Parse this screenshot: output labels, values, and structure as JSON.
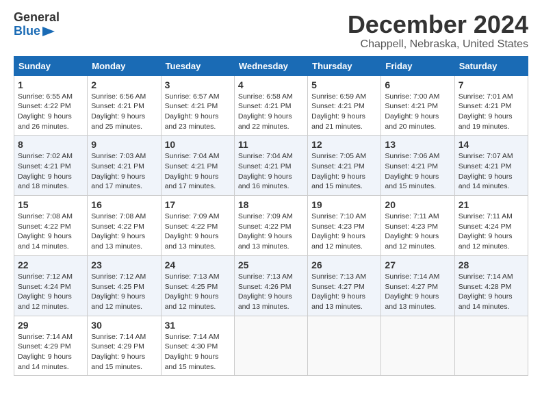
{
  "logo": {
    "line1": "General",
    "line2": "Blue"
  },
  "title": "December 2024",
  "location": "Chappell, Nebraska, United States",
  "weekdays": [
    "Sunday",
    "Monday",
    "Tuesday",
    "Wednesday",
    "Thursday",
    "Friday",
    "Saturday"
  ],
  "weeks": [
    [
      {
        "day": "1",
        "sunrise": "6:55 AM",
        "sunset": "4:22 PM",
        "daylight": "9 hours and 26 minutes."
      },
      {
        "day": "2",
        "sunrise": "6:56 AM",
        "sunset": "4:21 PM",
        "daylight": "9 hours and 25 minutes."
      },
      {
        "day": "3",
        "sunrise": "6:57 AM",
        "sunset": "4:21 PM",
        "daylight": "9 hours and 23 minutes."
      },
      {
        "day": "4",
        "sunrise": "6:58 AM",
        "sunset": "4:21 PM",
        "daylight": "9 hours and 22 minutes."
      },
      {
        "day": "5",
        "sunrise": "6:59 AM",
        "sunset": "4:21 PM",
        "daylight": "9 hours and 21 minutes."
      },
      {
        "day": "6",
        "sunrise": "7:00 AM",
        "sunset": "4:21 PM",
        "daylight": "9 hours and 20 minutes."
      },
      {
        "day": "7",
        "sunrise": "7:01 AM",
        "sunset": "4:21 PM",
        "daylight": "9 hours and 19 minutes."
      }
    ],
    [
      {
        "day": "8",
        "sunrise": "7:02 AM",
        "sunset": "4:21 PM",
        "daylight": "9 hours and 18 minutes."
      },
      {
        "day": "9",
        "sunrise": "7:03 AM",
        "sunset": "4:21 PM",
        "daylight": "9 hours and 17 minutes."
      },
      {
        "day": "10",
        "sunrise": "7:04 AM",
        "sunset": "4:21 PM",
        "daylight": "9 hours and 17 minutes."
      },
      {
        "day": "11",
        "sunrise": "7:04 AM",
        "sunset": "4:21 PM",
        "daylight": "9 hours and 16 minutes."
      },
      {
        "day": "12",
        "sunrise": "7:05 AM",
        "sunset": "4:21 PM",
        "daylight": "9 hours and 15 minutes."
      },
      {
        "day": "13",
        "sunrise": "7:06 AM",
        "sunset": "4:21 PM",
        "daylight": "9 hours and 15 minutes."
      },
      {
        "day": "14",
        "sunrise": "7:07 AM",
        "sunset": "4:21 PM",
        "daylight": "9 hours and 14 minutes."
      }
    ],
    [
      {
        "day": "15",
        "sunrise": "7:08 AM",
        "sunset": "4:22 PM",
        "daylight": "9 hours and 14 minutes."
      },
      {
        "day": "16",
        "sunrise": "7:08 AM",
        "sunset": "4:22 PM",
        "daylight": "9 hours and 13 minutes."
      },
      {
        "day": "17",
        "sunrise": "7:09 AM",
        "sunset": "4:22 PM",
        "daylight": "9 hours and 13 minutes."
      },
      {
        "day": "18",
        "sunrise": "7:09 AM",
        "sunset": "4:22 PM",
        "daylight": "9 hours and 13 minutes."
      },
      {
        "day": "19",
        "sunrise": "7:10 AM",
        "sunset": "4:23 PM",
        "daylight": "9 hours and 12 minutes."
      },
      {
        "day": "20",
        "sunrise": "7:11 AM",
        "sunset": "4:23 PM",
        "daylight": "9 hours and 12 minutes."
      },
      {
        "day": "21",
        "sunrise": "7:11 AM",
        "sunset": "4:24 PM",
        "daylight": "9 hours and 12 minutes."
      }
    ],
    [
      {
        "day": "22",
        "sunrise": "7:12 AM",
        "sunset": "4:24 PM",
        "daylight": "9 hours and 12 minutes."
      },
      {
        "day": "23",
        "sunrise": "7:12 AM",
        "sunset": "4:25 PM",
        "daylight": "9 hours and 12 minutes."
      },
      {
        "day": "24",
        "sunrise": "7:13 AM",
        "sunset": "4:25 PM",
        "daylight": "9 hours and 12 minutes."
      },
      {
        "day": "25",
        "sunrise": "7:13 AM",
        "sunset": "4:26 PM",
        "daylight": "9 hours and 13 minutes."
      },
      {
        "day": "26",
        "sunrise": "7:13 AM",
        "sunset": "4:27 PM",
        "daylight": "9 hours and 13 minutes."
      },
      {
        "day": "27",
        "sunrise": "7:14 AM",
        "sunset": "4:27 PM",
        "daylight": "9 hours and 13 minutes."
      },
      {
        "day": "28",
        "sunrise": "7:14 AM",
        "sunset": "4:28 PM",
        "daylight": "9 hours and 14 minutes."
      }
    ],
    [
      {
        "day": "29",
        "sunrise": "7:14 AM",
        "sunset": "4:29 PM",
        "daylight": "9 hours and 14 minutes."
      },
      {
        "day": "30",
        "sunrise": "7:14 AM",
        "sunset": "4:29 PM",
        "daylight": "9 hours and 15 minutes."
      },
      {
        "day": "31",
        "sunrise": "7:14 AM",
        "sunset": "4:30 PM",
        "daylight": "9 hours and 15 minutes."
      },
      null,
      null,
      null,
      null
    ]
  ],
  "labels": {
    "sunrise": "Sunrise:",
    "sunset": "Sunset:",
    "daylight": "Daylight:"
  }
}
